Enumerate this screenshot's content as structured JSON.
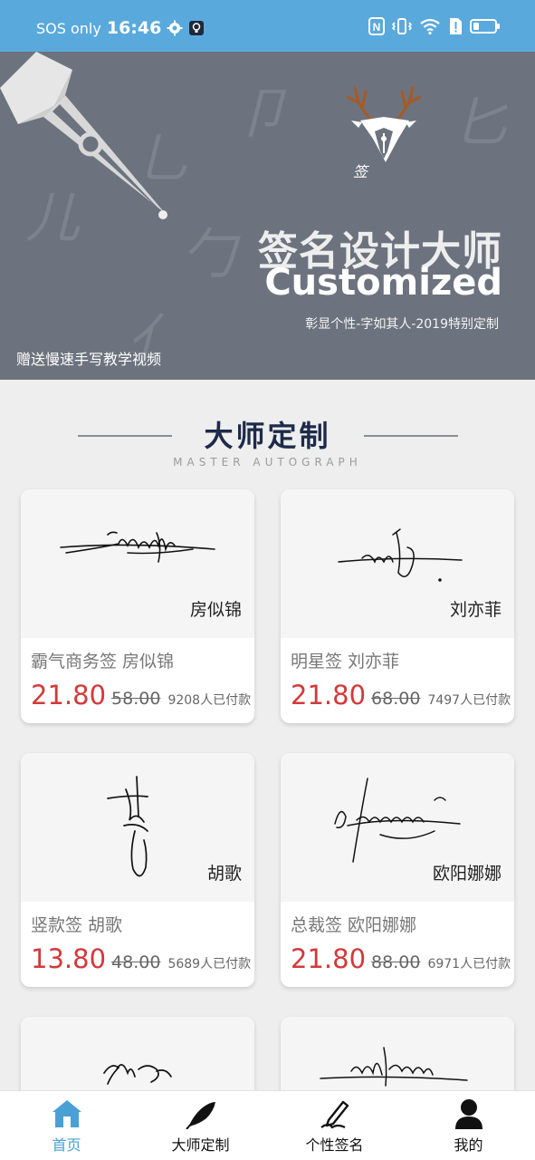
{
  "status_bar": {
    "carrier": "SOS only",
    "time": "16:46",
    "nfc_label": "N"
  },
  "banner": {
    "title": "签名设计大师",
    "subtitle": "Customized",
    "tagline": "彰显个性-字如其人-2019特别定制",
    "gift": "赠送慢速手写教学视频",
    "logo_text": "签"
  },
  "section": {
    "title": "大师定制",
    "subtitle": "MASTER AUTOGRAPH"
  },
  "cards": [
    {
      "sig_name": "房似锦",
      "title": "霸气商务签   房似锦",
      "price": "21.80",
      "old_price": "58.00",
      "paid": "9208人已付款"
    },
    {
      "sig_name": "刘亦菲",
      "title": "明星签   刘亦菲",
      "price": "21.80",
      "old_price": "68.00",
      "paid": "7497人已付款"
    },
    {
      "sig_name": "胡歌",
      "title": "竖款签   胡歌",
      "price": "13.80",
      "old_price": "48.00",
      "paid": "5689人已付款"
    },
    {
      "sig_name": "欧阳娜娜",
      "title": "总裁签   欧阳娜娜",
      "price": "21.80",
      "old_price": "88.00",
      "paid": "6971人已付款"
    }
  ],
  "tabs": [
    {
      "label": "首页",
      "icon": "home-icon",
      "active": true
    },
    {
      "label": "大师定制",
      "icon": "feather-icon",
      "active": false
    },
    {
      "label": "个性签名",
      "icon": "pen-icon",
      "active": false
    },
    {
      "label": "我的",
      "icon": "user-icon",
      "active": false
    }
  ],
  "colors": {
    "status_bar": "#5aa9dc",
    "banner_bg": "#6c737e",
    "price_red": "#d3393a",
    "tab_active": "#4aa0d5"
  }
}
